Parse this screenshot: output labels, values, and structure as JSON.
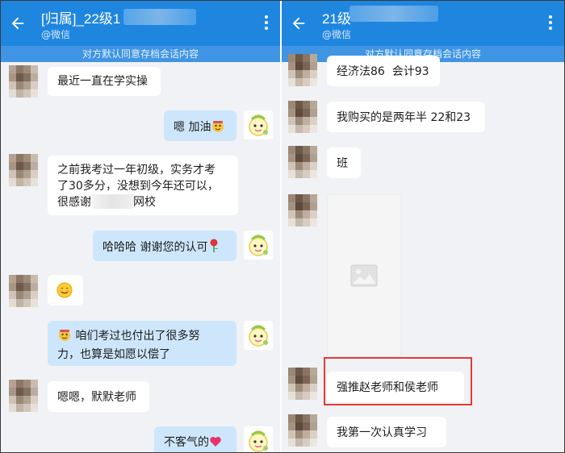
{
  "left": {
    "title": "[归属]_22级1",
    "subtitle": "@微信",
    "notice": "对方默认同意存档会话内容",
    "messages": [
      {
        "side": "in",
        "text": "最近一直在学实操"
      },
      {
        "side": "out",
        "text": "嗯 加油"
      },
      {
        "side": "in",
        "line1": "之前我考过一年初级，实务才考",
        "line2": "了30多分，没想到今年还可以，",
        "line3_prefix": "很感谢",
        "line3_suffix": "网校"
      },
      {
        "side": "out",
        "text": "哈哈哈 谢谢您的认可"
      },
      {
        "side": "in",
        "text": "emoji-smile"
      },
      {
        "side": "out",
        "line1": "咱们考过也付出了很多努",
        "line2": "力，也算是如愿以偿了"
      },
      {
        "side": "in",
        "text": "嗯嗯，默默老师"
      },
      {
        "side": "out",
        "text": "不客气的"
      }
    ]
  },
  "right": {
    "title": "21级",
    "subtitle": "@微信",
    "notice": "对方默认同意存档会话内容",
    "messages": [
      {
        "side": "in",
        "text": "经济法86  会计93"
      },
      {
        "side": "in",
        "text": "我购买的是两年半 22和23"
      },
      {
        "side": "in",
        "text": "班"
      },
      {
        "side": "in",
        "text": "image-icon"
      },
      {
        "side": "in",
        "text": "强推赵老师和侯老师"
      },
      {
        "side": "in",
        "text": "我第一次认真学习"
      }
    ]
  },
  "colors": {
    "appbar": "#1f86e0",
    "notice": "#3f95e3",
    "chat_bg": "#f1f2f5",
    "bubble_in": "#ffffff",
    "bubble_out": "#cde6fb",
    "highlight": "#e53935"
  }
}
